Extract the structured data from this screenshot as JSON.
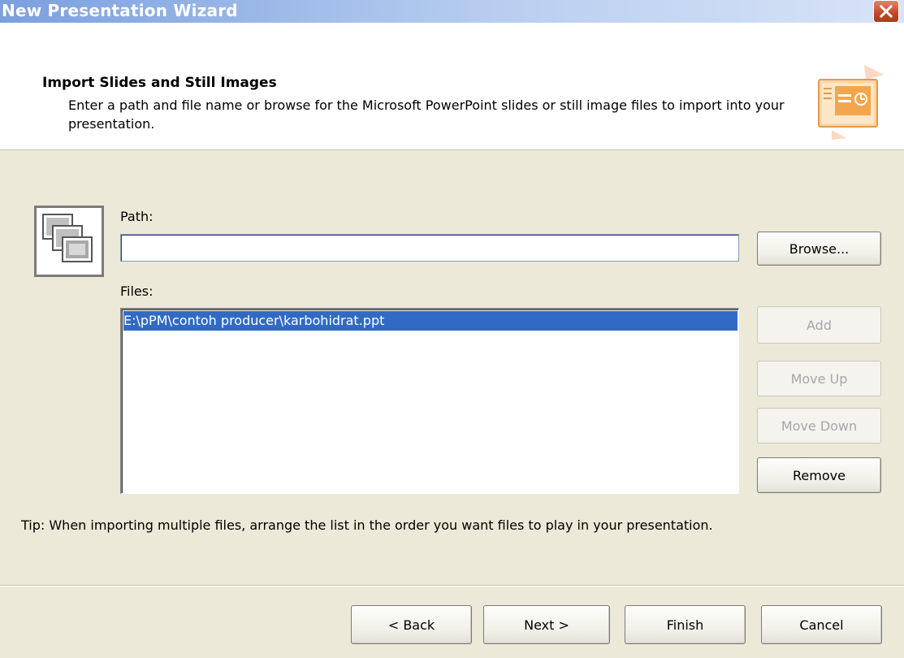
{
  "window": {
    "title": "New Presentation Wizard",
    "close_icon": "close-icon"
  },
  "header": {
    "title": "Import Slides and Still Images",
    "description": "Enter a path and file name or browse for the Microsoft PowerPoint slides or still image files to import into your presentation.",
    "icon": "presentation-wizard-icon"
  },
  "form": {
    "icon": "slides-stack-icon",
    "path_label": "Path:",
    "path_value": "",
    "browse_label": "Browse...",
    "files_label": "Files:",
    "files": [
      "E:\\pPM\\contoh producer\\karbohidrat.ppt"
    ],
    "add_label": "Add",
    "move_up_label": "Move Up",
    "move_down_label": "Move Down",
    "remove_label": "Remove"
  },
  "tip": "Tip: When importing multiple files, arrange the list in the order you want files to play in your presentation.",
  "footer": {
    "back_label": "< Back",
    "next_label": "Next >",
    "finish_label": "Finish",
    "cancel_label": "Cancel"
  }
}
